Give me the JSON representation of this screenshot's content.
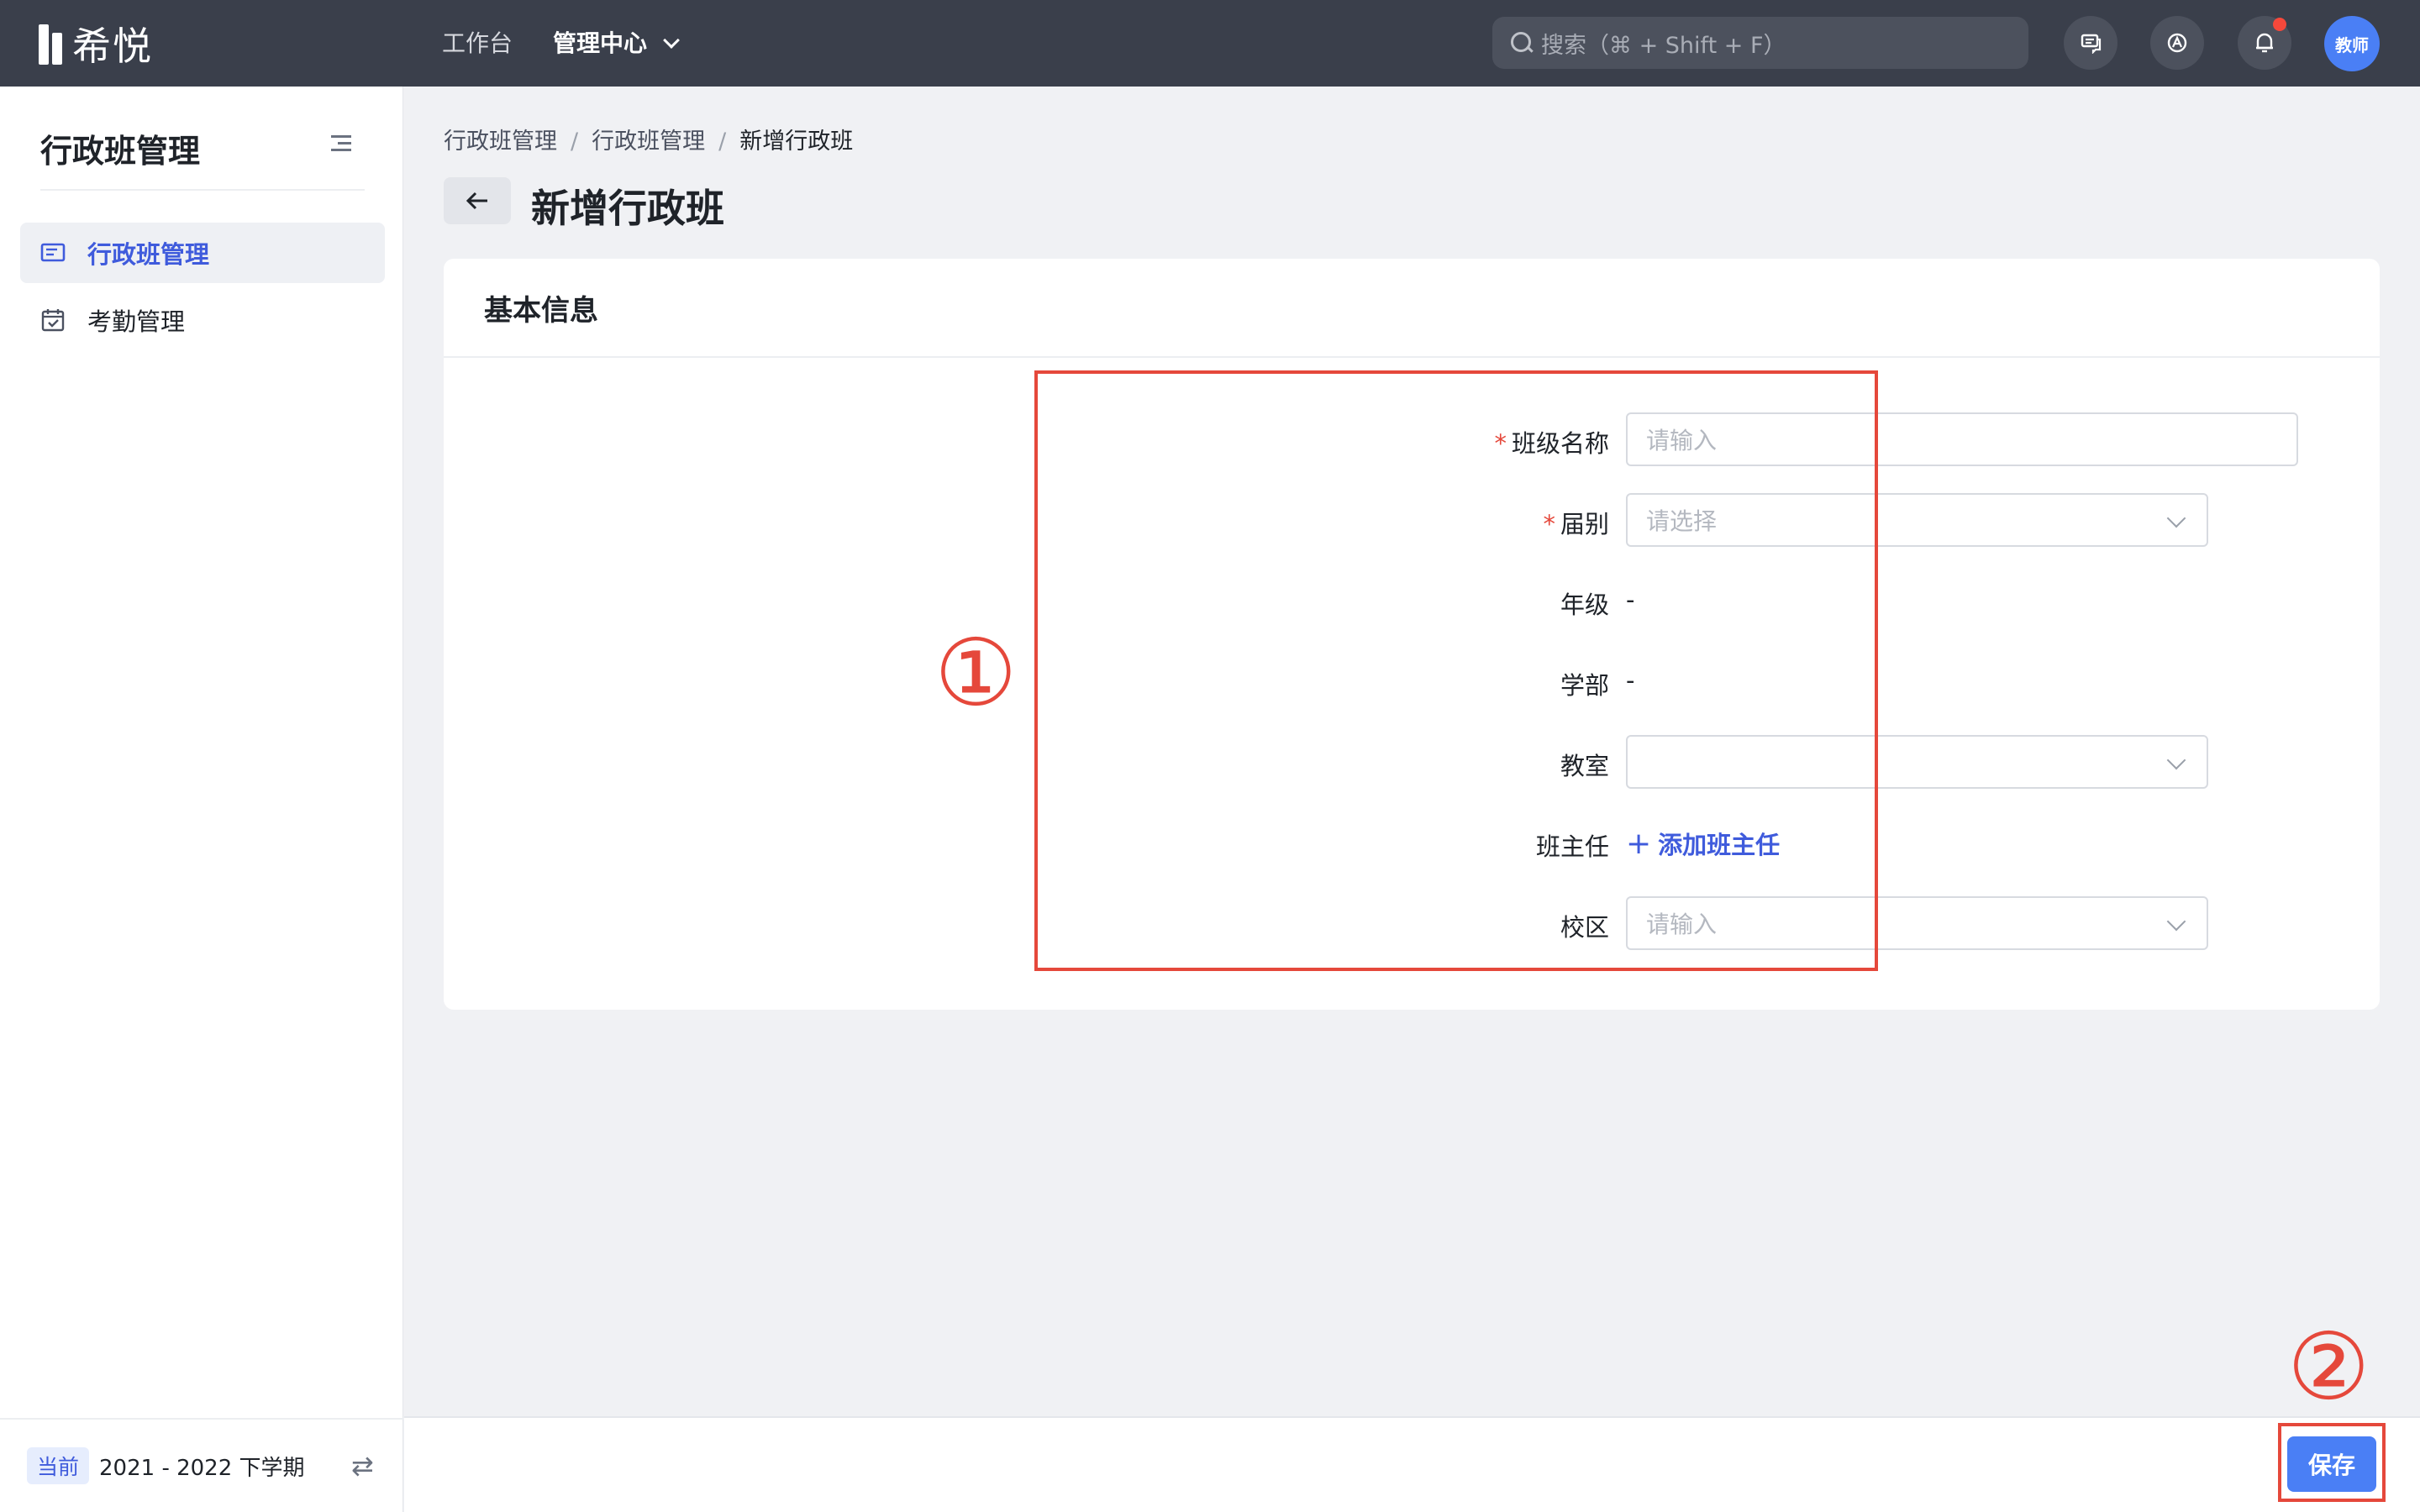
{
  "app": {
    "logo_text": "希悦"
  },
  "topnav": {
    "workbench": "工作台",
    "admin_center": "管理中心",
    "search_placeholder": "搜索（⌘ + Shift + F）",
    "avatar_text": "教师"
  },
  "sidebar": {
    "title": "行政班管理",
    "items": [
      {
        "label": "行政班管理",
        "active": true,
        "icon": "class-list-icon"
      },
      {
        "label": "考勤管理",
        "active": false,
        "icon": "calendar-check-icon"
      }
    ],
    "term_tag": "当前",
    "term_text": "2021 - 2022 下学期"
  },
  "breadcrumb": [
    "行政班管理",
    "行政班管理",
    "新增行政班"
  ],
  "page": {
    "title": "新增行政班"
  },
  "card": {
    "title": "基本信息",
    "fields": {
      "class_name": {
        "label": "班级名称",
        "required": true,
        "placeholder": "请输入"
      },
      "cohort": {
        "label": "届别",
        "required": true,
        "placeholder": "请选择"
      },
      "grade": {
        "label": "年级",
        "value": "-"
      },
      "department": {
        "label": "学部",
        "value": "-"
      },
      "classroom": {
        "label": "教室",
        "value": ""
      },
      "head_teacher": {
        "label": "班主任",
        "action": "添加班主任"
      },
      "campus": {
        "label": "校区",
        "placeholder": "请输入"
      }
    }
  },
  "footer": {
    "save_label": "保存"
  },
  "annotations": {
    "one": "①",
    "two": "②"
  },
  "colors": {
    "accent": "#4a7ff5",
    "link": "#3f5bdc",
    "annotation": "#e5483b",
    "topbar": "#3a3f4b"
  }
}
